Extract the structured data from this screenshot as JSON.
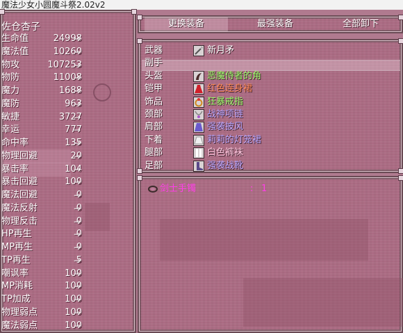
{
  "window": {
    "title": "魔法少女小圆魔斗祭2.02v2"
  },
  "character": {
    "name": "佐仓杏子"
  },
  "stats": [
    {
      "label": "生命值",
      "value": "24998",
      "arrow": "→"
    },
    {
      "label": "魔法值",
      "value": "10260",
      "arrow": "→"
    },
    {
      "label": "物攻",
      "value": "107253",
      "arrow": "→"
    },
    {
      "label": "物防",
      "value": "11008",
      "arrow": "→"
    },
    {
      "label": "魔力",
      "value": "1688",
      "arrow": "→"
    },
    {
      "label": "魔防",
      "value": "963",
      "arrow": "→"
    },
    {
      "label": "敏捷",
      "value": "3727",
      "arrow": "→"
    },
    {
      "label": "幸运",
      "value": "777",
      "arrow": "→"
    },
    {
      "label": "命中率",
      "value": "135",
      "arrow": "→"
    },
    {
      "label": "物理回避",
      "value": "20",
      "arrow": "→"
    },
    {
      "label": "暴击率",
      "value": "104",
      "arrow": "→"
    },
    {
      "label": "暴击回避",
      "value": "100",
      "arrow": "→"
    },
    {
      "label": "魔法回避",
      "value": "0",
      "arrow": "→"
    },
    {
      "label": "魔法反射",
      "value": "0",
      "arrow": "→"
    },
    {
      "label": "物理反击",
      "value": "0",
      "arrow": "→"
    },
    {
      "label": "HP再生",
      "value": "0",
      "arrow": "→"
    },
    {
      "label": "MP再生",
      "value": "0",
      "arrow": "→"
    },
    {
      "label": "TP再生",
      "value": "5",
      "arrow": "→"
    },
    {
      "label": "嘲讽率",
      "value": "100",
      "arrow": "→"
    },
    {
      "label": "MP消耗",
      "value": "100",
      "arrow": "→"
    },
    {
      "label": "TP加成",
      "value": "100",
      "arrow": "→"
    },
    {
      "label": "物理弱点",
      "value": "100",
      "arrow": "→"
    },
    {
      "label": "魔法弱点",
      "value": "100",
      "arrow": "→"
    }
  ],
  "commands": {
    "change": "更换装备",
    "best": "最强装备",
    "remove_all": "全部卸下"
  },
  "equipment": [
    {
      "slot": "武器",
      "item": "新月矛",
      "icon": "spear-icon",
      "color": "#ffffff"
    },
    {
      "slot": "副手",
      "item": "",
      "icon": "",
      "color": "#ffffff"
    },
    {
      "slot": "头盔",
      "item": "恶魔侍者的角",
      "icon": "horn-icon",
      "color": "#9cff6a"
    },
    {
      "slot": "铠甲",
      "item": "红色连身裙",
      "icon": "dress-icon",
      "color": "#ff8a5a"
    },
    {
      "slot": "饰品",
      "item": "狂暴戒指",
      "icon": "ring-icon",
      "color": "#9cff6a"
    },
    {
      "slot": "颈部",
      "item": "战神项链",
      "icon": "necklace-icon",
      "color": "#b9a7ff"
    },
    {
      "slot": "肩部",
      "item": "强袭披风",
      "icon": "cloak-icon",
      "color": "#b9a7ff"
    },
    {
      "slot": "下着",
      "item": "莉莉的灯笼裙",
      "icon": "skirt-icon",
      "color": "#b9a7ff"
    },
    {
      "slot": "腿部",
      "item": "白色裤袜",
      "icon": "stockings-icon",
      "color": "#ffc8e0"
    },
    {
      "slot": "足部",
      "item": "强袭战靴",
      "icon": "boots-icon",
      "color": "#b9a7ff"
    }
  ],
  "inventory": [
    {
      "name": "剑士手镯",
      "colon": ":",
      "count": "1",
      "icon": "bracelet-icon",
      "color": "#ff3fe8"
    }
  ]
}
